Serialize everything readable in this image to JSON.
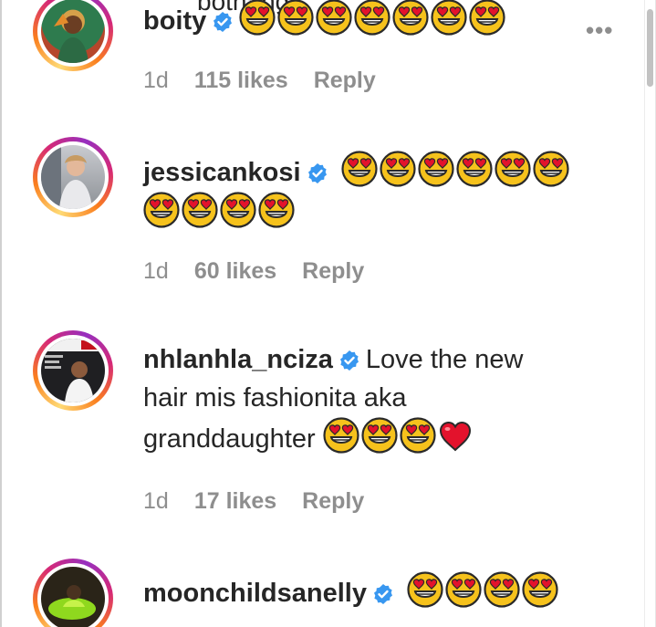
{
  "cut_off_text": "bothang",
  "comments": [
    {
      "username": "boity",
      "verified": true,
      "text": "",
      "emojis": [
        "heart-eyes",
        "heart-eyes",
        "heart-eyes",
        "heart-eyes",
        "heart-eyes",
        "heart-eyes",
        "heart-eyes"
      ],
      "time": "1d",
      "likes": "115 likes",
      "reply": "Reply",
      "more_label": "•••"
    },
    {
      "username": "jessicankosi",
      "verified": true,
      "text": "",
      "emojis": [
        "heart-eyes",
        "heart-eyes",
        "heart-eyes",
        "heart-eyes",
        "heart-eyes",
        "heart-eyes",
        "heart-eyes",
        "heart-eyes",
        "heart-eyes",
        "heart-eyes"
      ],
      "time": "1d",
      "likes": "60 likes",
      "reply": "Reply"
    },
    {
      "username": "nhlanhla_nciza",
      "verified": true,
      "text_line1": "Love the new",
      "text_line2": "hair mis fashionita aka",
      "text_line3": "granddaughter",
      "emojis": [
        "heart-eyes",
        "heart-eyes",
        "heart-eyes",
        "red-heart"
      ],
      "time": "1d",
      "likes": "17 likes",
      "reply": "Reply"
    },
    {
      "username": "moonchildsanelly",
      "verified": true,
      "text": "",
      "emojis": [
        "heart-eyes",
        "heart-eyes",
        "heart-eyes",
        "heart-eyes"
      ]
    }
  ],
  "colors": {
    "verified_blue": "#3897f0",
    "muted_text": "#8e8e8e",
    "emoji_face": "#f6c21c",
    "heart_red": "#e3122c"
  }
}
